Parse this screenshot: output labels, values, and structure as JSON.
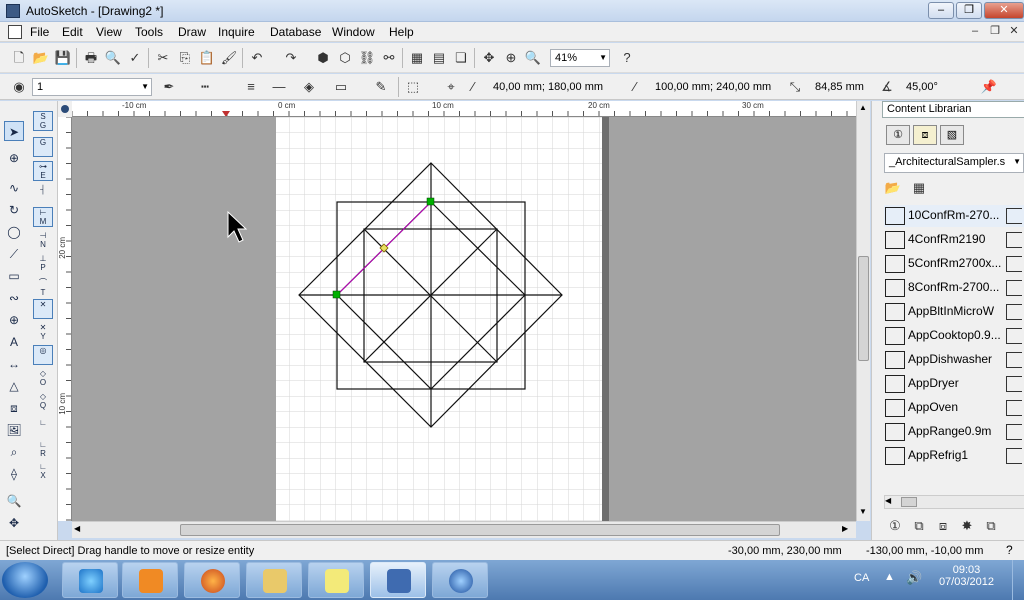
{
  "window": {
    "title": "AutoSketch - [Drawing2 *]",
    "minimize": "–",
    "restore": "❐",
    "close": "✕"
  },
  "menu": [
    "File",
    "Edit",
    "View",
    "Tools",
    "Draw",
    "Inquire",
    "Database",
    "Window",
    "Help"
  ],
  "toolbar": {
    "zoom_value": "41%"
  },
  "properties_bar": {
    "layer_value": "1",
    "point1": "40,00 mm; 180,00 mm",
    "point2": "100,00 mm; 240,00 mm",
    "length": "84,85 mm",
    "angle": "45,00°"
  },
  "ruler": {
    "h_labels": [
      "-10 cm",
      "0 cm",
      "10 cm",
      "20 cm",
      "30 cm"
    ],
    "v_labels": [
      "20 cm",
      "10 cm"
    ]
  },
  "panel": {
    "title": "Content Librarian",
    "library": "_ArchitecturalSampler.s",
    "items": [
      "10ConfRm-270...",
      "4ConfRm2190",
      "5ConfRm2700x...",
      "8ConfRm-2700...",
      "AppBltInMicroW",
      "AppCooktop0.9...",
      "AppDishwasher",
      "AppDryer",
      "AppOven",
      "AppRange0.9m",
      "AppRefrig1"
    ]
  },
  "status": {
    "message": "[Select Direct] Drag handle to move or resize entity",
    "coord1": "-30,00 mm, 230,00 mm",
    "coord2": "-130,00 mm, -10,00 mm"
  },
  "taskbar": {
    "language": "CA",
    "time": "09:03",
    "date": "07/03/2012"
  },
  "colors": {
    "selection_line": "#c000c0",
    "handle": "#00b000",
    "page": "#ffffff",
    "canvas_bg": "#a3a3a3"
  }
}
